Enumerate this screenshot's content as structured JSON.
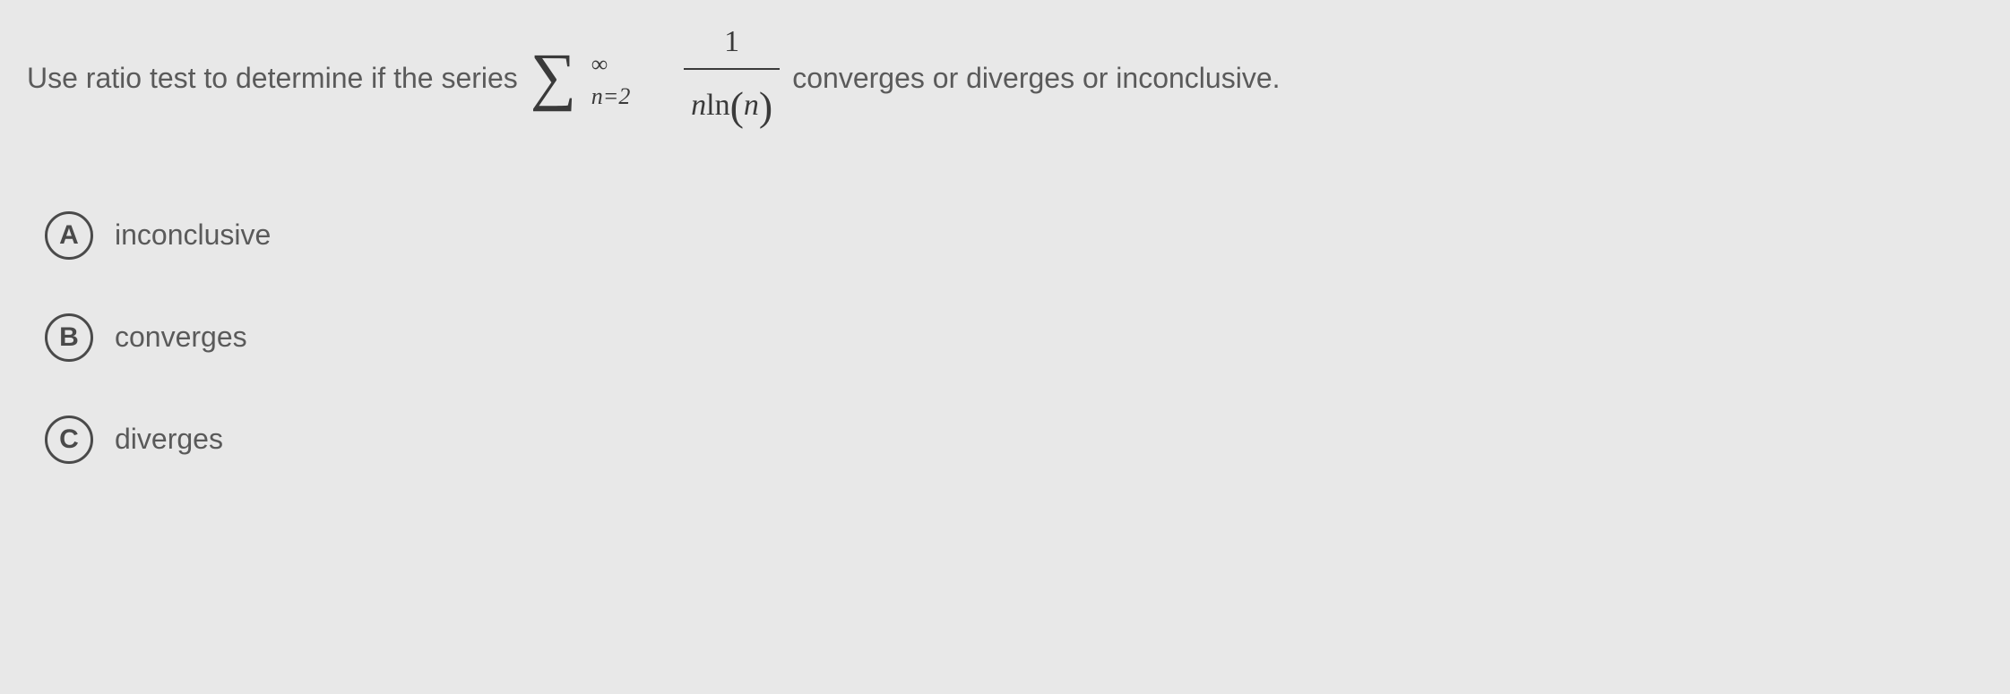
{
  "question": {
    "part1": "Use ratio test to determine if the series",
    "part2": "converges or diverges or inconclusive.",
    "sigma_symbol": "∑",
    "sigma_upper": "∞",
    "sigma_lower": "n=2",
    "frac_num": "1",
    "frac_den_n": "n",
    "frac_den_ln": "ln",
    "frac_den_arg": "n"
  },
  "options": [
    {
      "letter": "A",
      "text": "inconclusive"
    },
    {
      "letter": "B",
      "text": "converges"
    },
    {
      "letter": "C",
      "text": "diverges"
    }
  ]
}
